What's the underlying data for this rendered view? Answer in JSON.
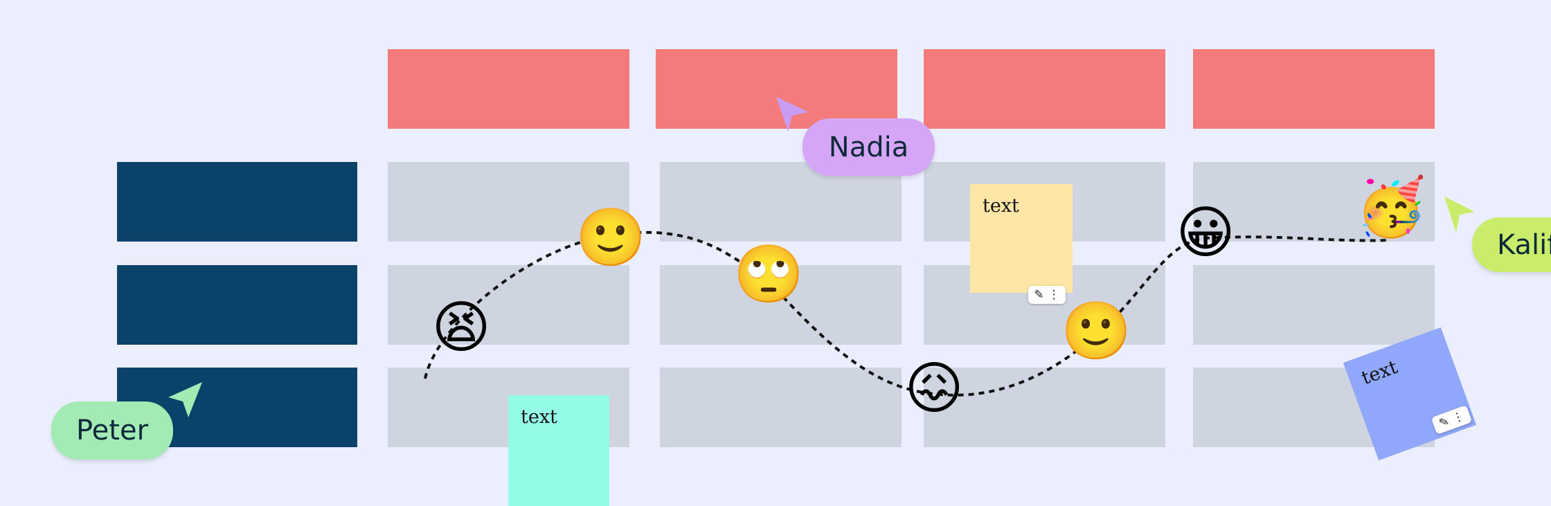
{
  "board": {
    "header_color": "#f47b7b",
    "row_label_color": "#0a4269",
    "cell_color": "#cfd5e0",
    "background": "#ebeefd"
  },
  "stickies": [
    {
      "text": "text",
      "color": "#ffe6a6"
    },
    {
      "text": "text",
      "color": "#94fce6"
    },
    {
      "text": "text",
      "color": "#90a7fb"
    }
  ],
  "sticky_actions": {
    "edit_icon": "edit-icon",
    "more_icon": "more-vertical-icon"
  },
  "emojis": [
    "😫",
    "🙂",
    "🙄",
    "😖",
    "🙂",
    "😀",
    "🥳"
  ],
  "cursors": [
    {
      "name": "Nadia",
      "color": "#d5a6f5"
    },
    {
      "name": "Kalif",
      "color": "#c9ec6a"
    },
    {
      "name": "Peter",
      "color": "#a3eab5"
    }
  ]
}
